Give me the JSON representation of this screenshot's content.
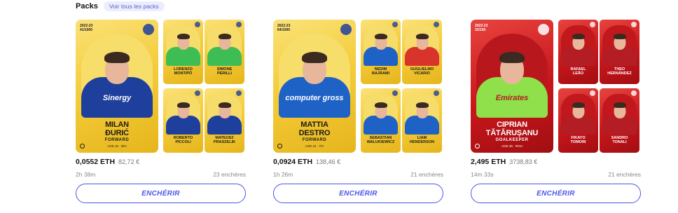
{
  "header": {
    "title": "Packs",
    "link": "Voir tous les packs"
  },
  "colors": {
    "accent": "#4b57e6",
    "gold": "#f4cd3b",
    "red": "#c8161b"
  },
  "packs": [
    {
      "big": {
        "scarcity": "2022-23\n41/1000",
        "name_line1": "MILAN",
        "name_line2": "ĐURIĆ",
        "position": "FORWARD",
        "meta": "AGE 32 · BIH",
        "shirt": "#1f3f9c",
        "shirt_text": "Sinergy",
        "theme": "gold"
      },
      "small": [
        {
          "line1": "LORENZO",
          "line2": "MONTIPÒ",
          "shirt": "#3fbd55",
          "theme": "gold"
        },
        {
          "line1": "SIMONE",
          "line2": "PERILLI",
          "shirt": "#3fbd55",
          "theme": "gold"
        },
        {
          "line1": "ROBERTO",
          "line2": "PICCOLI",
          "shirt": "#1f3f9c",
          "theme": "gold"
        },
        {
          "line1": "MATEUSZ",
          "line2": "PRASZELIK",
          "shirt": "#1f3f9c",
          "theme": "gold"
        }
      ],
      "price": "0,0552 ETH",
      "fiat": "82,72 €",
      "time": "2h 38m",
      "bids": "23 enchères",
      "button": "ENCHÉRIR"
    },
    {
      "big": {
        "scarcity": "2022-23\n64/1000",
        "name_line1": "MATTIA",
        "name_line2": "DESTRO",
        "position": "FORWARD",
        "meta": "AGE 31 · ITA",
        "shirt": "#1f62c6",
        "shirt_text": "computer gross",
        "theme": "gold"
      },
      "small": [
        {
          "line1": "NEDIM",
          "line2": "BAJRAMI",
          "shirt": "#1f62c6",
          "theme": "gold"
        },
        {
          "line1": "GUGLIELMO",
          "line2": "VICARIO",
          "shirt": "#d8342c",
          "theme": "gold"
        },
        {
          "line1": "SEBASTIAN",
          "line2": "WALUKIEWICZ",
          "shirt": "#1f62c6",
          "theme": "gold"
        },
        {
          "line1": "LIAM",
          "line2": "HENDERSON",
          "shirt": "#1f62c6",
          "theme": "gold"
        }
      ],
      "price": "0,0924 ETH",
      "fiat": "138,46 €",
      "time": "1h 26m",
      "bids": "21 enchères",
      "button": "ENCHÉRIR"
    },
    {
      "big": {
        "scarcity": "2022-23\n32/100",
        "name_line1": "CIPRIAN",
        "name_line2": "TĂTĂRUȘANU",
        "position": "GOALKEEPER",
        "meta": "AGE 36 · ROU",
        "shirt": "#8fe04a",
        "shirt_text": "Emirates",
        "theme": "red"
      },
      "small": [
        {
          "line1": "RAFAEL",
          "line2": "LEÃO",
          "shirt": "#b31d23",
          "theme": "red"
        },
        {
          "line1": "THEO",
          "line2": "HERNÁNDEZ",
          "shirt": "#b31d23",
          "theme": "red"
        },
        {
          "line1": "FIKAYO",
          "line2": "TOMORI",
          "shirt": "#b31d23",
          "theme": "red"
        },
        {
          "line1": "SANDRO",
          "line2": "TONALI",
          "shirt": "#b31d23",
          "theme": "red"
        }
      ],
      "price": "2,495 ETH",
      "fiat": "3738,83 €",
      "time": "14m 33s",
      "bids": "21 enchères",
      "button": "ENCHÉRIR"
    }
  ]
}
